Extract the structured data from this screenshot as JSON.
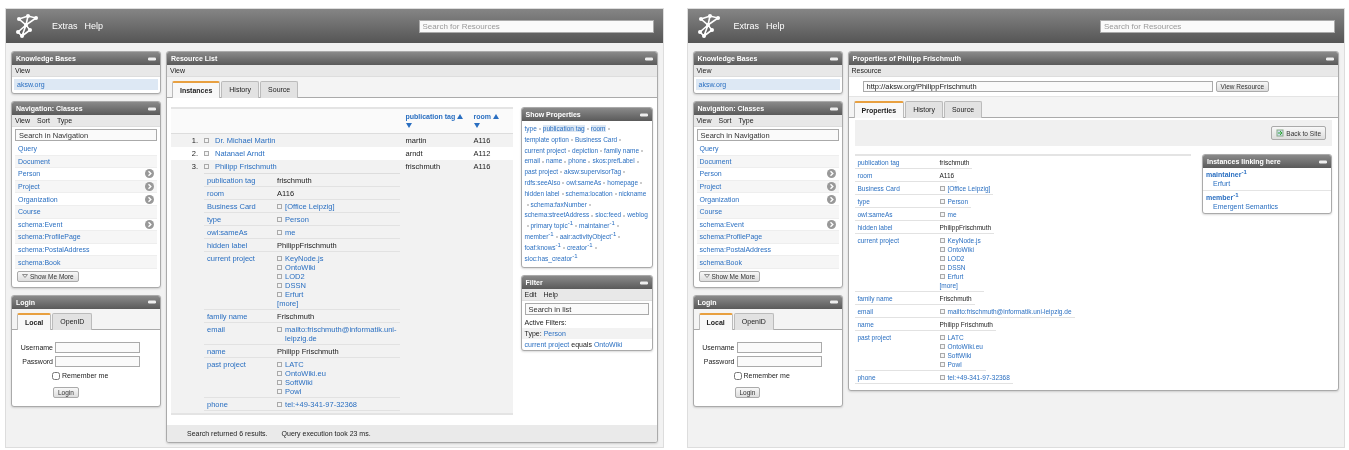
{
  "screens": [
    {
      "header": {
        "menu": [
          "Extras",
          "Help"
        ],
        "search_placeholder": "Search for Resources"
      },
      "sidebar": {
        "knowledge_bases": {
          "title": "Knowledge Bases",
          "menu": [
            "View"
          ],
          "items": [
            {
              "label": "aksw.org",
              "selected": true
            }
          ]
        },
        "navigation": {
          "title": "Navigation: Classes",
          "menu": [
            "View",
            "Sort",
            "Type"
          ],
          "search_placeholder": "Search in Navigation",
          "items": [
            {
              "label": "Query",
              "has_children": false
            },
            {
              "label": "Document",
              "has_children": false
            },
            {
              "label": "Person",
              "has_children": true
            },
            {
              "label": "Project",
              "has_children": true
            },
            {
              "label": "Organization",
              "has_children": true
            },
            {
              "label": "Course",
              "has_children": false
            },
            {
              "label": "schema:Event",
              "has_children": true
            },
            {
              "label": "schema:ProfilePage",
              "has_children": false
            },
            {
              "label": "schema:PostalAddress",
              "has_children": false
            },
            {
              "label": "schema:Book",
              "has_children": false
            }
          ],
          "more_button": "Show Me More"
        },
        "login": {
          "title": "Login",
          "tabs": [
            {
              "label": "Local",
              "selected": true
            },
            {
              "label": "OpenID",
              "selected": false
            }
          ],
          "username_label": "Username",
          "password_label": "Password",
          "remember": {
            "label": "Remember me",
            "checked": false
          },
          "button": "Login"
        }
      },
      "main": {
        "kind": "resource_list",
        "title": "Resource List",
        "menu": [
          "View"
        ],
        "tabs": [
          {
            "label": "Instances",
            "selected": true
          },
          {
            "label": "History",
            "selected": false
          },
          {
            "label": "Source",
            "selected": false
          }
        ],
        "columns": [
          "publication tag",
          "room"
        ],
        "rows": [
          {
            "number": "1.",
            "label": "Dr. Michael Martin",
            "cells": [
              "martin",
              "A116"
            ]
          },
          {
            "number": "2.",
            "label": "Natanael Arndt",
            "cells": [
              "arndt",
              "A112"
            ]
          },
          {
            "number": "3.",
            "label": "Philipp Frischmuth",
            "cells": [
              "frischmuth",
              "A116"
            ],
            "properties": [
              {
                "label": "publication tag",
                "values": [
                  {
                    "kind": "literal",
                    "text": "frischmuth"
                  }
                ]
              },
              {
                "label": "room",
                "values": [
                  {
                    "kind": "literal",
                    "text": "A116"
                  }
                ]
              },
              {
                "label": "Business Card",
                "values": [
                  {
                    "kind": "resource",
                    "text": "[Office Leipzig]"
                  }
                ]
              },
              {
                "label": "type",
                "values": [
                  {
                    "kind": "resource",
                    "text": "Person"
                  }
                ]
              },
              {
                "label": "owl:sameAs",
                "values": [
                  {
                    "kind": "resource",
                    "text": "me"
                  }
                ]
              },
              {
                "label": "hidden label",
                "values": [
                  {
                    "kind": "literal",
                    "text": "PhilippFrischmuth"
                  }
                ]
              },
              {
                "label": "current project",
                "values": [
                  {
                    "kind": "resource",
                    "text": "KeyNode.js"
                  },
                  {
                    "kind": "resource",
                    "text": "OntoWiki"
                  },
                  {
                    "kind": "resource",
                    "text": "LOD2"
                  },
                  {
                    "kind": "resource",
                    "text": "DSSN"
                  },
                  {
                    "kind": "resource",
                    "text": "Erfurt"
                  },
                  {
                    "kind": "more",
                    "text": "[more]"
                  }
                ]
              },
              {
                "label": "family name",
                "values": [
                  {
                    "kind": "literal",
                    "text": "Frischmuth"
                  }
                ]
              },
              {
                "label": "email",
                "values": [
                  {
                    "kind": "resource",
                    "text": "mailto:frischmuth@informatik.uni-leipzig.de"
                  }
                ]
              },
              {
                "label": "name",
                "values": [
                  {
                    "kind": "literal",
                    "text": "Philipp Frischmuth"
                  }
                ]
              },
              {
                "label": "past project",
                "values": [
                  {
                    "kind": "resource",
                    "text": "LATC"
                  },
                  {
                    "kind": "resource",
                    "text": "OntoWiki.eu"
                  },
                  {
                    "kind": "resource",
                    "text": "SoftWiki"
                  },
                  {
                    "kind": "resource",
                    "text": "Powl"
                  }
                ]
              },
              {
                "label": "phone",
                "values": [
                  {
                    "kind": "resource",
                    "text": "tel:+49-341-97-32368"
                  }
                ]
              }
            ]
          }
        ],
        "status": [
          "Search returned 6 results.",
          "Query execution took 23 ms."
        ],
        "show_properties": {
          "title": "Show Properties",
          "items": [
            {
              "label": "type",
              "selected": false
            },
            {
              "label": "publication tag",
              "selected": true
            },
            {
              "label": "room",
              "selected": true
            },
            {
              "label": "template option",
              "selected": false
            },
            {
              "label": "Business Card",
              "selected": false
            },
            {
              "label": "current project",
              "selected": false
            },
            {
              "label": "depiction",
              "selected": false
            },
            {
              "label": "family name",
              "selected": false
            },
            {
              "label": "email",
              "selected": false
            },
            {
              "label": "name",
              "selected": false
            },
            {
              "label": "phone",
              "selected": false
            },
            {
              "label": "skos:prefLabel",
              "selected": false
            },
            {
              "label": "past project",
              "selected": false
            },
            {
              "label": "aksw:supervisorTag",
              "selected": false
            },
            {
              "label": "rdfs:seeAlso",
              "selected": false
            },
            {
              "label": "owl:sameAs",
              "selected": false
            },
            {
              "label": "homepage",
              "selected": false
            },
            {
              "label": "hidden label",
              "selected": false
            },
            {
              "label": "schema:location",
              "selected": false
            },
            {
              "label": "nickname",
              "selected": false
            },
            {
              "label": "schema:faxNumber",
              "selected": false
            },
            {
              "label": "schema:streetAddress",
              "selected": false
            },
            {
              "label": "sioc:feed",
              "selected": false
            },
            {
              "label": "weblog",
              "selected": false
            },
            {
              "label": "primary topic$^{-1}$",
              "selected": false
            },
            {
              "label": "maintainer$^{-1}$",
              "selected": false
            },
            {
              "label": "member$^{-1}$",
              "selected": false
            },
            {
              "label": "aair:activityObject$^{-1}$",
              "selected": false
            },
            {
              "label": "foaf:knows$^{-1}$",
              "selected": false
            },
            {
              "label": "creator$^{-1}$",
              "selected": false
            },
            {
              "label": "sioc:has_creator$^{-1}$",
              "selected": false
            }
          ]
        },
        "filter": {
          "title": "Filter",
          "menu": [
            "Edit",
            "Help"
          ],
          "search_placeholder": "Search in list",
          "active_label": "Active Filters:",
          "filters": [
            [
              {
                "text": "Type:",
                "link": false
              },
              {
                "text": "Person",
                "link": true
              }
            ],
            [
              {
                "text": "current project",
                "link": true
              },
              {
                "text": "equals",
                "link": false
              },
              {
                "text": "OntoWiki",
                "link": true
              }
            ]
          ]
        }
      }
    },
    {
      "header": {
        "menu": [
          "Extras",
          "Help"
        ],
        "search_placeholder": "Search for Resources"
      },
      "sidebar": {
        "knowledge_bases": {
          "title": "Knowledge Bases",
          "menu": [
            "View"
          ],
          "items": [
            {
              "label": "aksw.org",
              "selected": true
            }
          ]
        },
        "navigation": {
          "title": "Navigation: Classes",
          "menu": [
            "View",
            "Sort",
            "Type"
          ],
          "search_placeholder": "Search in Navigation",
          "items": [
            {
              "label": "Query",
              "has_children": false
            },
            {
              "label": "Document",
              "has_children": false
            },
            {
              "label": "Person",
              "has_children": true
            },
            {
              "label": "Project",
              "has_children": true
            },
            {
              "label": "Organization",
              "has_children": true
            },
            {
              "label": "Course",
              "has_children": false
            },
            {
              "label": "schema:Event",
              "has_children": true
            },
            {
              "label": "schema:ProfilePage",
              "has_children": false
            },
            {
              "label": "schema:PostalAddress",
              "has_children": false
            },
            {
              "label": "schema:Book",
              "has_children": false
            }
          ],
          "more_button": "Show Me More"
        },
        "login": {
          "title": "Login",
          "tabs": [
            {
              "label": "Local",
              "selected": true
            },
            {
              "label": "OpenID",
              "selected": false
            }
          ],
          "username_label": "Username",
          "password_label": "Password",
          "remember": {
            "label": "Remember me",
            "checked": false
          },
          "button": "Login"
        }
      },
      "main": {
        "kind": "properties",
        "title": "Properties of Philipp Frischmuth",
        "menu": [
          "Resource"
        ],
        "uri": "http://aksw.org/PhilippFrischmuth",
        "view_button": "View Resource",
        "tabs": [
          {
            "label": "Properties",
            "selected": true
          },
          {
            "label": "History",
            "selected": false
          },
          {
            "label": "Source",
            "selected": false
          }
        ],
        "back_button": "Back to Site",
        "properties": [
          {
            "label": "publication tag",
            "values": [
              {
                "kind": "literal",
                "text": "frischmuth"
              }
            ]
          },
          {
            "label": "room",
            "values": [
              {
                "kind": "literal",
                "text": "A116"
              }
            ]
          },
          {
            "label": "Business Card",
            "values": [
              {
                "kind": "resource",
                "text": "[Office Leipzig]"
              }
            ]
          },
          {
            "label": "type",
            "values": [
              {
                "kind": "resource",
                "text": "Person"
              }
            ]
          },
          {
            "label": "owl:sameAs",
            "values": [
              {
                "kind": "resource",
                "text": "me"
              }
            ]
          },
          {
            "label": "hidden label",
            "values": [
              {
                "kind": "literal",
                "text": "PhilippFrischmuth"
              }
            ]
          },
          {
            "label": "current project",
            "values": [
              {
                "kind": "resource",
                "text": "KeyNode.js"
              },
              {
                "kind": "resource",
                "text": "OntoWiki"
              },
              {
                "kind": "resource",
                "text": "LOD2"
              },
              {
                "kind": "resource",
                "text": "DSSN"
              },
              {
                "kind": "resource",
                "text": "Erfurt"
              },
              {
                "kind": "more",
                "text": "[more]"
              }
            ]
          },
          {
            "label": "family name",
            "values": [
              {
                "kind": "literal",
                "text": "Frischmuth"
              }
            ]
          },
          {
            "label": "email",
            "values": [
              {
                "kind": "resource",
                "text": "mailto:frischmuth@informatik.uni-leipzig.de"
              }
            ]
          },
          {
            "label": "name",
            "values": [
              {
                "kind": "literal",
                "text": "Philipp Frischmuth"
              }
            ]
          },
          {
            "label": "past project",
            "values": [
              {
                "kind": "resource",
                "text": "LATC"
              },
              {
                "kind": "resource",
                "text": "OntoWiki.eu"
              },
              {
                "kind": "resource",
                "text": "SoftWiki"
              },
              {
                "kind": "resource",
                "text": "Powl"
              }
            ]
          },
          {
            "label": "phone",
            "values": [
              {
                "kind": "resource",
                "text": "tel:+49-341-97-32368"
              }
            ]
          }
        ],
        "linking": {
          "title": "Instances linking here",
          "groups": [
            {
              "property": "maintainer$^{-1}$",
              "items": [
                "Erfurt"
              ]
            },
            {
              "property": "member$^{-1}$",
              "items": [
                "Emergent Semantics"
              ]
            }
          ]
        }
      }
    }
  ]
}
